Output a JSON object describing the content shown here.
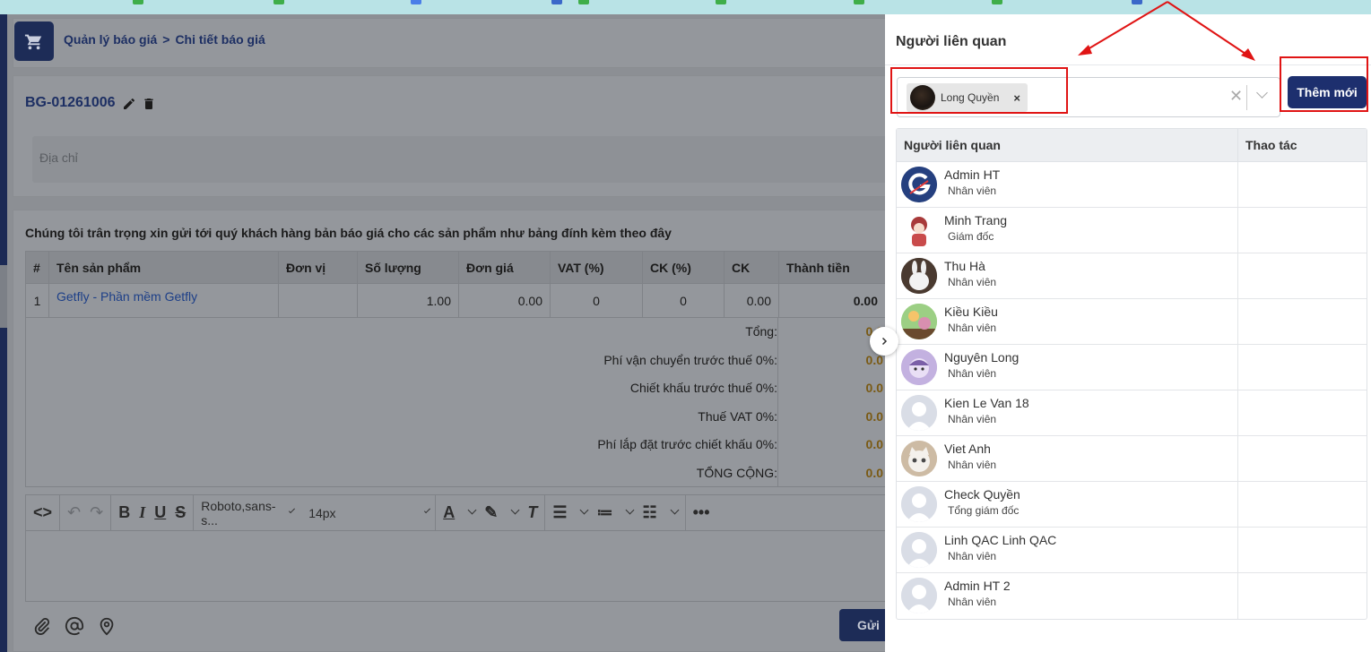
{
  "breadcrumb": {
    "parent": "Quản lý báo giá",
    "separator": ">",
    "current": "Chi tiết báo giá"
  },
  "quote": {
    "code": "BG-01261006"
  },
  "address": {
    "placeholder": "Địa chỉ"
  },
  "intro_text": "Chúng tôi trân trọng xin gửi tới quý khách hàng bản báo giá cho các sản phẩm như bảng đính kèm theo đây",
  "product_table": {
    "headers": [
      "#",
      "Tên sản phẩm",
      "Đơn vị",
      "Số lượng",
      "Đơn giá",
      "VAT (%)",
      "CK (%)",
      "CK",
      "Thành tiền"
    ],
    "rows": [
      {
        "index": "1",
        "name": "Getfly - Phần mềm Getfly",
        "unit": "",
        "quantity": "1.00",
        "price": "0.00",
        "vat": "0",
        "ck_percent": "0",
        "ck": "0.00",
        "total": "0.00"
      }
    ]
  },
  "totals": [
    {
      "label": "Tổng:",
      "value": "0.0"
    },
    {
      "label": "Phí vận chuyển trước thuế 0%:",
      "value": "0.0"
    },
    {
      "label": "Chiết khấu trước thuế 0%:",
      "value": "0.0"
    },
    {
      "label": "Thuế VAT 0%:",
      "value": "0.0"
    },
    {
      "label": "Phí lắp đặt trước chiết khấu 0%:",
      "value": "0.0"
    },
    {
      "label": "TỔNG CỘNG:",
      "value": "0.0"
    }
  ],
  "editor": {
    "font_family": "Roboto,sans-s...",
    "font_size": "14px"
  },
  "send_label": "Gửi",
  "panel": {
    "title": "Người liên quan",
    "selected": [
      {
        "name": "Long Quyền"
      }
    ],
    "add_button": "Thêm mới",
    "table_headers": {
      "person": "Người liên quan",
      "action": "Thao tác"
    },
    "people": [
      {
        "name": "Admin HT",
        "role": "Nhân viên"
      },
      {
        "name": "Minh Trang",
        "role": "Giám đốc"
      },
      {
        "name": "Thu Hà",
        "role": "Nhân viên"
      },
      {
        "name": "Kiều Kiều",
        "role": "Nhân viên"
      },
      {
        "name": "Nguyên Long",
        "role": "Nhân viên"
      },
      {
        "name": "Kien Le Van 18",
        "role": "Nhân viên"
      },
      {
        "name": "Viet Anh",
        "role": "Nhân viên"
      },
      {
        "name": "Check Quyền",
        "role": "Tổng giám đốc"
      },
      {
        "name": "Linh QAC Linh QAC",
        "role": "Nhân viên"
      },
      {
        "name": "Admin HT 2",
        "role": "Nhân viên"
      }
    ]
  },
  "colors": {
    "primary": "#1d2f6e",
    "annotation_red": "#e01414",
    "overlay": "#8c8f94",
    "total_value": "#7a5a14"
  }
}
